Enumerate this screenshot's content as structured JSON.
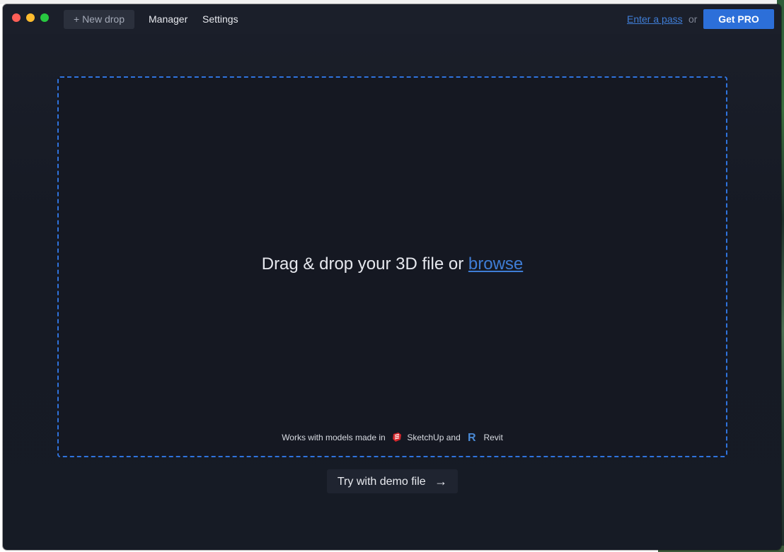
{
  "toolbar": {
    "new_drop_label": "+ New drop",
    "nav_items": [
      "Manager",
      "Settings"
    ],
    "enter_pass_label": "Enter a pass",
    "or_label": "or",
    "get_pro_label": "Get PRO"
  },
  "dropzone": {
    "prompt_text": "Drag & drop your 3D file or",
    "browse_label": "browse",
    "works_with_prefix": "Works with models made in",
    "sketchup_label": "SketchUp and",
    "revit_label": "Revit"
  },
  "demo": {
    "label": "Try with demo file",
    "arrow": "→"
  },
  "icons": {
    "sketchup": "sketchup-icon",
    "revit": "revit-icon"
  },
  "colors": {
    "accent": "#2c6fd9",
    "link": "#3f7dd6",
    "background": "#161a24"
  }
}
